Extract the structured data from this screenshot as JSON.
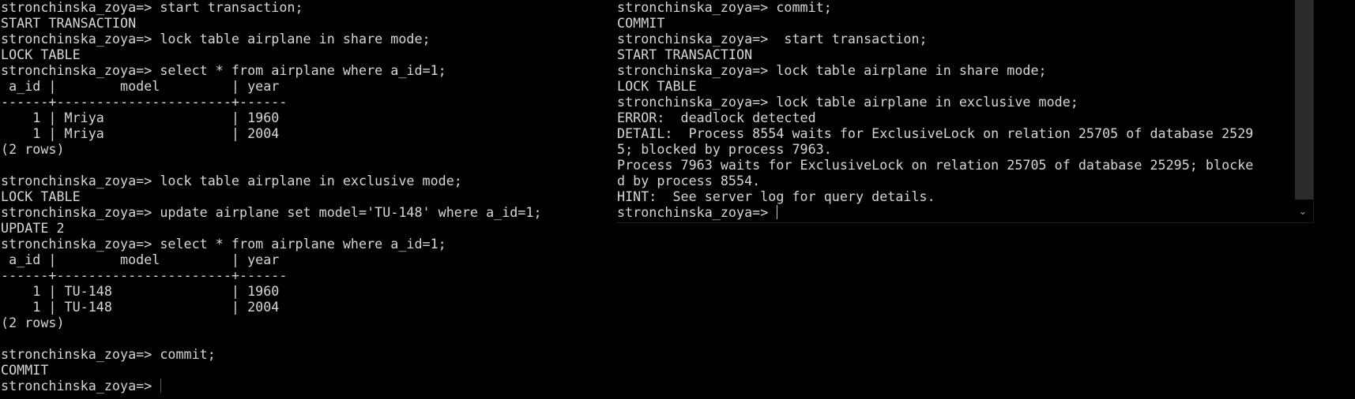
{
  "left_console": {
    "lines": [
      "stronchinska_zoya=> start transaction;",
      "START TRANSACTION",
      "stronchinska_zoya=> lock table airplane in share mode;",
      "LOCK TABLE",
      "stronchinska_zoya=> select * from airplane where a_id=1;",
      " a_id |        model         | year",
      "------+----------------------+------",
      "    1 | Mriya                | 1960",
      "    1 | Mriya                | 2004",
      "(2 rows)",
      "",
      "stronchinska_zoya=> lock table airplane in exclusive mode;",
      "LOCK TABLE",
      "stronchinska_zoya=> update airplane set model='TU-148' where a_id=1;",
      "UPDATE 2",
      "stronchinska_zoya=> select * from airplane where a_id=1;",
      " a_id |        model         | year",
      "------+----------------------+------",
      "    1 | TU-148               | 1960",
      "    1 | TU-148               | 2004",
      "(2 rows)",
      "",
      "stronchinska_zoya=> commit;",
      "COMMIT"
    ],
    "prompt": "stronchinska_zoya=> "
  },
  "right_console": {
    "lines": [
      "stronchinska_zoya=> commit;",
      "COMMIT",
      "stronchinska_zoya=>  start transaction;",
      "START TRANSACTION",
      "stronchinska_zoya=> lock table airplane in share mode;",
      "LOCK TABLE",
      "stronchinska_zoya=> lock table airplane in exclusive mode;",
      "ERROR:  deadlock detected",
      "DETAIL:  Process 8554 waits for ExclusiveLock on relation 25705 of database 2529",
      "5; blocked by process 7963.",
      "Process 7963 waits for ExclusiveLock on relation 25705 of database 25295; blocke",
      "d by process 8554.",
      "HINT:  See server log for query details."
    ],
    "prompt": "stronchinska_zoya=> "
  },
  "icons": {
    "scroll_down": "chevron-down-icon"
  },
  "colors": {
    "background": "#000000",
    "text": "#d6d6d6",
    "scrollbar_thumb": "#2c2c2c"
  }
}
